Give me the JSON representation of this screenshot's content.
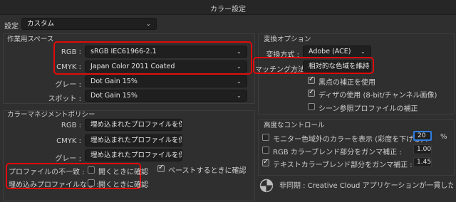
{
  "window": {
    "title": "カラー設定"
  },
  "settings": {
    "label": "設定 :",
    "value": "カスタム"
  },
  "working_spaces": {
    "title": "作業用スペース",
    "rows": [
      {
        "label": "RGB :",
        "value": "sRGB IEC61966-2.1"
      },
      {
        "label": "CMYK :",
        "value": "Japan Color 2011 Coated"
      },
      {
        "label": "グレー :",
        "value": "Dot Gain 15%"
      },
      {
        "label": "スポット :",
        "value": "Dot Gain 15%"
      }
    ]
  },
  "color_management": {
    "title": "カラーマネジメントポリシー",
    "rows": [
      {
        "label": "RGB :",
        "value": "埋め込まれたプロファイルを保持"
      },
      {
        "label": "CMYK :",
        "value": "埋め込まれたプロファイルを保持"
      },
      {
        "label": "グレー :",
        "value": "埋め込まれたプロファイルを保持"
      }
    ],
    "profile_mismatch": {
      "label": "プロファイルの不一致 :",
      "checkbox_label": "開くときに確認",
      "checked": false
    },
    "paste_ask": {
      "label": "ペーストするときに確認",
      "checked": true
    },
    "missing_profile": {
      "label": "埋め込みプロファイルなし :",
      "checkbox_label": "開くときに確認",
      "checked": false
    }
  },
  "conversion": {
    "title": "変換オプション",
    "engine_label": "変換方式 :",
    "engine_value": "Adobe (ACE)",
    "intent_label": "マッチング方法 :",
    "intent_value": "相対的な色域を維持",
    "options": [
      {
        "label": "黒点の補正を使用",
        "checked": true
      },
      {
        "label": "ディザの使用 (8-bit/チャンネル画像)",
        "checked": true
      },
      {
        "label": "シーン参照プロファイルの補正",
        "checked": false
      }
    ]
  },
  "advanced": {
    "title": "高度なコントロール",
    "rows": [
      {
        "label": "モニター色域外のカラーを表示 (彩度を下げる) :",
        "value": "20",
        "unit": "%",
        "checked": false
      },
      {
        "label": "RGB カラーブレンド部分をガンマ補正 :",
        "value": "1.00",
        "unit": "",
        "checked": false
      },
      {
        "label": "テキストカラーブレンド部分をガンマ補正 :",
        "value": "1.45",
        "unit": "",
        "checked": true
      }
    ]
  },
  "sync_status": {
    "text": "非同期 : Creative Cloud アプリケーションが一貫したカラー設定に同…"
  },
  "colors": {
    "highlight": "#e10a0a",
    "focus": "#2f7de1",
    "background": "#2f2f2f"
  }
}
